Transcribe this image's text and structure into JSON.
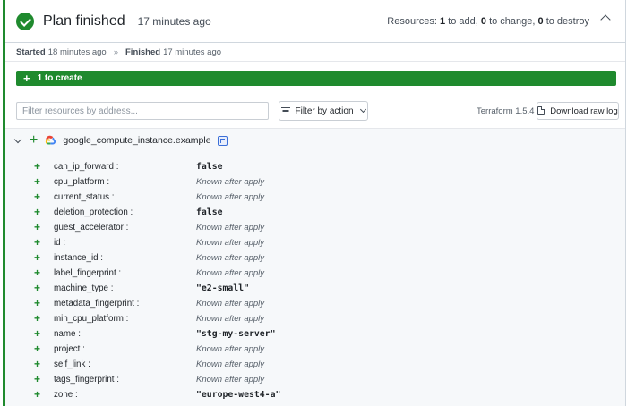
{
  "header": {
    "title": "Plan finished",
    "time_ago": "17 minutes ago",
    "resources": {
      "prefix": "Resources: ",
      "add_count": "1",
      "add_label": " to add, ",
      "change_count": "0",
      "change_label": " to change, ",
      "destroy_count": "0",
      "destroy_label": " to destroy"
    }
  },
  "timing": {
    "started_label": "Started",
    "started_value": "18 minutes ago",
    "separator": "»",
    "finished_label": "Finished",
    "finished_value": "17 minutes ago"
  },
  "summary": {
    "plus": "+",
    "label": "1 to create"
  },
  "controls": {
    "filter_placeholder": "Filter resources by address...",
    "filter_value": "",
    "filter_button_label": "Filter by action",
    "terraform_version": "Terraform 1.5.4",
    "download_label": "Download raw log"
  },
  "resource": {
    "plus": "+",
    "name": "google_compute_instance.example",
    "attributes": [
      {
        "name": "can_ip_forward :",
        "value": "false",
        "kind": "literal"
      },
      {
        "name": "cpu_platform :",
        "value": "Known after apply",
        "kind": "known"
      },
      {
        "name": "current_status :",
        "value": "Known after apply",
        "kind": "known"
      },
      {
        "name": "deletion_protection :",
        "value": "false",
        "kind": "literal"
      },
      {
        "name": "guest_accelerator :",
        "value": "Known after apply",
        "kind": "known"
      },
      {
        "name": "id :",
        "value": "Known after apply",
        "kind": "known"
      },
      {
        "name": "instance_id :",
        "value": "Known after apply",
        "kind": "known"
      },
      {
        "name": "label_fingerprint :",
        "value": "Known after apply",
        "kind": "known"
      },
      {
        "name": "machine_type :",
        "value": "\"e2-small\"",
        "kind": "literal"
      },
      {
        "name": "metadata_fingerprint :",
        "value": "Known after apply",
        "kind": "known"
      },
      {
        "name": "min_cpu_platform :",
        "value": "Known after apply",
        "kind": "known"
      },
      {
        "name": "name :",
        "value": "\"stg-my-server\"",
        "kind": "literal"
      },
      {
        "name": "project :",
        "value": "Known after apply",
        "kind": "known"
      },
      {
        "name": "self_link :",
        "value": "Known after apply",
        "kind": "known"
      },
      {
        "name": "tags_fingerprint :",
        "value": "Known after apply",
        "kind": "known"
      },
      {
        "name": "zone :",
        "value": "\"europe-west4-a\"",
        "kind": "literal"
      }
    ]
  },
  "icons": {
    "status": "check-circle-icon",
    "collapse": "chevron-up-icon",
    "filter": "filter-icon",
    "dropdown": "chevron-down-icon",
    "download": "document-icon",
    "provider": "google-cloud-icon",
    "copy": "copy-icon"
  },
  "colors": {
    "create_green": "#1f8a2e",
    "copy_blue": "#3b6fd8"
  }
}
